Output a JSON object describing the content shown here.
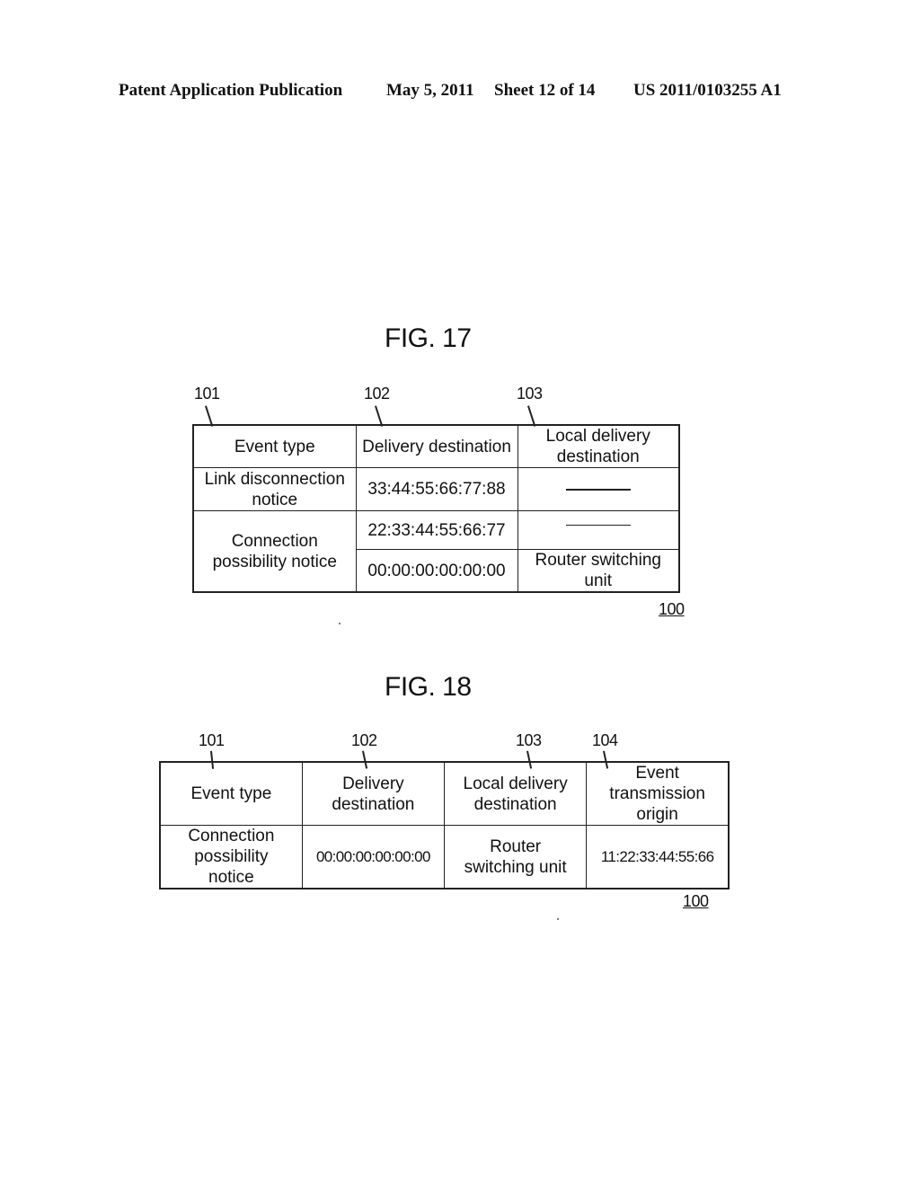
{
  "header": {
    "publication": "Patent Application Publication",
    "date": "May 5, 2011",
    "sheet": "Sheet 12 of 14",
    "number": "US 2011/0103255 A1"
  },
  "fig17": {
    "title": "FIG. 17",
    "refs": [
      "101",
      "102",
      "103"
    ],
    "table_label": "100",
    "headers": [
      "Event type",
      "Delivery destination",
      "Local delivery destination"
    ],
    "rows": [
      {
        "event_type": "Link disconnection notice",
        "delivery_destination": "33:44:55:66:77:88",
        "local_delivery_destination": "—"
      },
      {
        "event_type": "Connection possibility notice",
        "delivery_destination": "22:33:44:55:66:77",
        "local_delivery_destination": "—"
      },
      {
        "event_type": "Connection possibility notice",
        "delivery_destination": "00:00:00:00:00:00",
        "local_delivery_destination": "Router switching unit"
      }
    ]
  },
  "fig18": {
    "title": "FIG. 18",
    "refs": [
      "101",
      "102",
      "103",
      "104"
    ],
    "table_label": "100",
    "headers": [
      "Event type",
      "Delivery destination",
      "Local delivery destination",
      "Event transmission origin"
    ],
    "rows": [
      {
        "event_type": "Connection possibility notice",
        "delivery_destination": "00:00:00:00:00:00",
        "local_delivery_destination": "Router switching unit",
        "event_transmission_origin": "11:22:33:44:55:66"
      }
    ]
  }
}
